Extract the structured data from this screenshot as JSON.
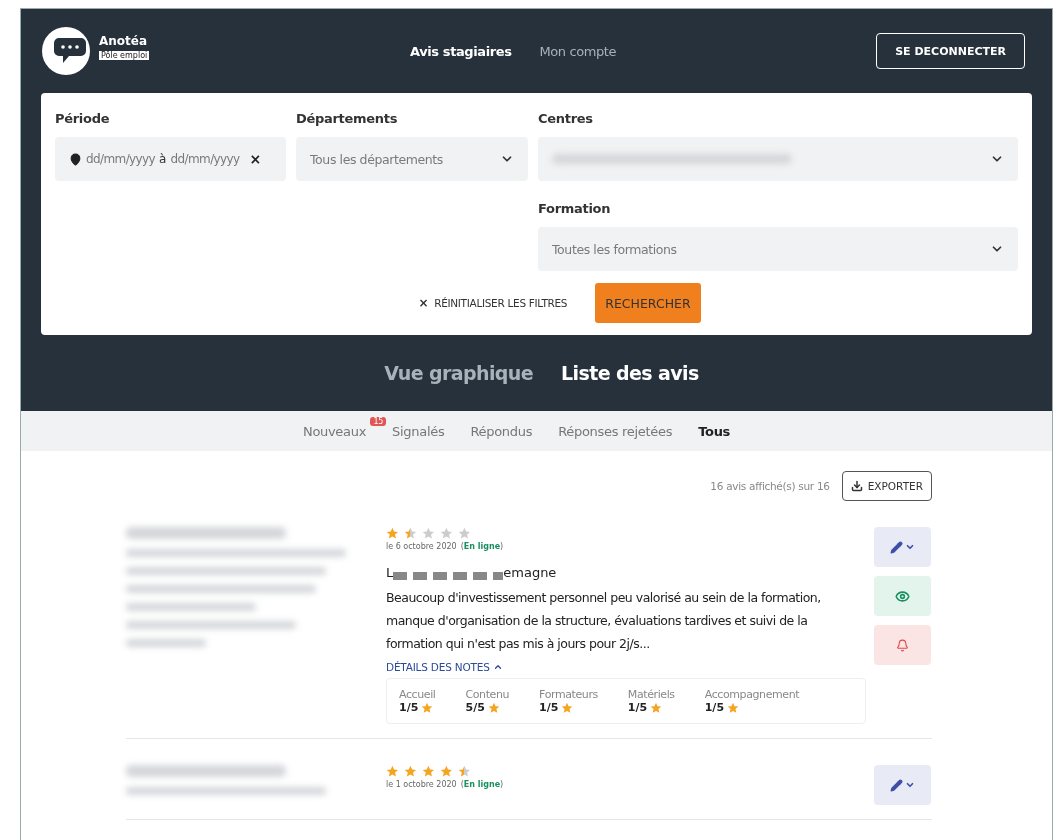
{
  "header": {
    "brand": "Anotéa",
    "brand_tag": "Pôle emploi",
    "nav": [
      {
        "label": "Avis stagiaires",
        "selected": true
      },
      {
        "label": "Mon compte",
        "selected": false
      }
    ],
    "logout": "SE DECONNECTER"
  },
  "filters": {
    "periode": {
      "label": "Période",
      "from": "dd/mm/yyyy",
      "separator": "à",
      "to": "dd/mm/yyyy",
      "clear": "×"
    },
    "departements": {
      "label": "Départements",
      "placeholder": "Tous les départements"
    },
    "centres": {
      "label": "Centres"
    },
    "formation": {
      "label": "Formation",
      "placeholder": "Toutes les formations"
    },
    "reset": "RÉINITIALISER LES FILTRES",
    "reset_icon": "×",
    "search": "RECHERCHER"
  },
  "views": [
    {
      "label": "Vue graphique",
      "selected": false
    },
    {
      "label": "Liste des avis",
      "selected": true
    }
  ],
  "tabs": [
    {
      "label": "Nouveaux",
      "badge": "15",
      "selected": false
    },
    {
      "label": "Signalés",
      "selected": false
    },
    {
      "label": "Répondus",
      "selected": false
    },
    {
      "label": "Réponses rejetées",
      "selected": false
    },
    {
      "label": "Tous",
      "selected": true
    }
  ],
  "count": "16 avis affiché(s) sur 16",
  "export": "EXPORTER",
  "reviews": [
    {
      "stars": 1.5,
      "date": "le 6 octobre 2020",
      "status": "(**En ligne**)",
      "title_start": "L",
      "title_end": "emagne",
      "text": "Beaucoup d'investissement personnel peu valorisé au sein de la formation, manque d'organisation de la structure, évaluations tardives et suivi de la formation qui n'est pas mis à jours pour 2j/s...",
      "details_label": "DÉTAILS DES NOTES",
      "expanded": true,
      "notes": [
        {
          "label": "Accueil",
          "value": "1/5"
        },
        {
          "label": "Contenu",
          "value": "5/5"
        },
        {
          "label": "Formateurs",
          "value": "1/5"
        },
        {
          "label": "Matériels",
          "value": "1/5"
        },
        {
          "label": "Accompagnement",
          "value": "1/5"
        }
      ],
      "actions": [
        {
          "kind": "edit"
        },
        {
          "kind": "publish"
        },
        {
          "kind": "report"
        }
      ]
    },
    {
      "stars": 4.5,
      "date": "le 1 octobre 2020",
      "status": "(**En ligne**)",
      "actions": [
        {
          "kind": "edit"
        }
      ]
    }
  ]
}
